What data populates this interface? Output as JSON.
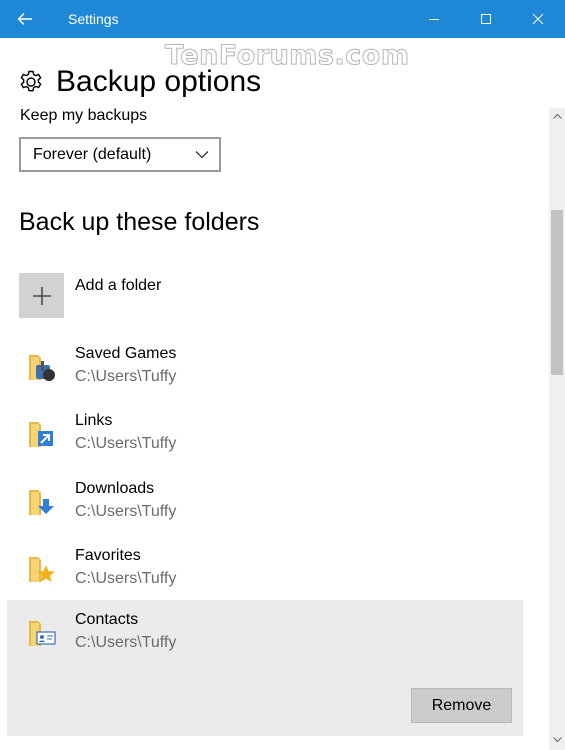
{
  "window": {
    "title": "Settings",
    "icons": {
      "back": "back-arrow-icon",
      "minimize": "minimize-icon",
      "maximize": "maximize-icon",
      "close": "close-icon"
    },
    "accent_color": "#1e87d6"
  },
  "watermark": "TenForums.com",
  "page": {
    "title": "Backup options",
    "icon": "gear-icon"
  },
  "keep": {
    "label": "Keep my backups",
    "selected": "Forever (default)"
  },
  "folders_section": {
    "title": "Back up these folders",
    "add_label": "Add a folder",
    "items": [
      {
        "name": "Saved Games",
        "path": "C:\\Users\\Tuffy",
        "icon": "saved-games-folder-icon"
      },
      {
        "name": "Links",
        "path": "C:\\Users\\Tuffy",
        "icon": "links-folder-icon"
      },
      {
        "name": "Downloads",
        "path": "C:\\Users\\Tuffy",
        "icon": "downloads-folder-icon"
      },
      {
        "name": "Favorites",
        "path": "C:\\Users\\Tuffy",
        "icon": "favorites-folder-icon"
      },
      {
        "name": "Contacts",
        "path": "C:\\Users\\Tuffy",
        "icon": "contacts-folder-icon",
        "selected": true
      }
    ],
    "remove_label": "Remove"
  }
}
